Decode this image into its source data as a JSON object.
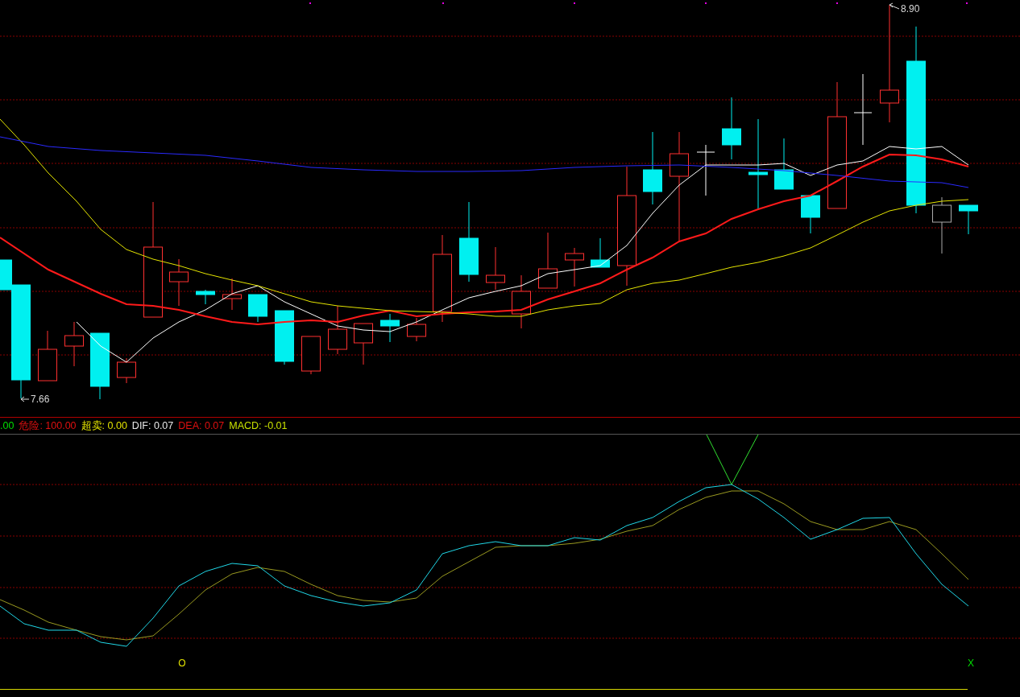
{
  "price_chart": {
    "high_label": "8.90",
    "low_label": "7.66"
  },
  "indicator_legend": [
    {
      "text": ".00",
      "color": "#00dd00"
    },
    {
      "text": "危险: 100.00",
      "color": "#e01010"
    },
    {
      "text": "超卖: 0.00",
      "color": "#e0e000"
    },
    {
      "text": "DIF: 0.07",
      "color": "#e8e8e8"
    },
    {
      "text": "DEA: 0.07",
      "color": "#e01010"
    },
    {
      "text": "MACD: -0.01",
      "color": "#c8e000"
    }
  ],
  "signals": [
    {
      "text": "O",
      "color": "#e0e000"
    },
    {
      "text": "X",
      "color": "#00dd00"
    }
  ]
}
